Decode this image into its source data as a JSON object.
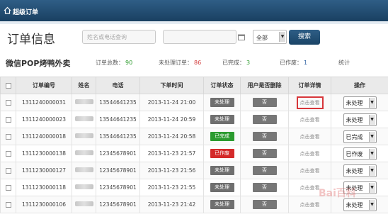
{
  "titlebar": {
    "title": "超级订单"
  },
  "heading": "订单信息",
  "search": {
    "placeholder": "姓名或电话查询",
    "date_value": "",
    "select_value": "全部",
    "button_label": "搜索"
  },
  "shop": {
    "name": "微信POP烤鸭外卖",
    "stats": [
      {
        "label": "订单总数：",
        "value": "90",
        "color": "#2e9b2e"
      },
      {
        "label": "未处理订单：",
        "value": "86",
        "color": "#d23a3a"
      },
      {
        "label": "已完成：",
        "value": "3",
        "color": "#2e9b2e"
      },
      {
        "label": "已作废：",
        "value": "1",
        "color": "#2a5ea0"
      },
      {
        "label": "统计",
        "value": "",
        "color": "#555"
      }
    ]
  },
  "table": {
    "headers": [
      "订单编号",
      "姓名",
      "电话",
      "下单时间",
      "订单状态",
      "用户是否删除",
      "订单详情",
      "操作"
    ],
    "rows": [
      {
        "id": "1311240000031",
        "phone": "13544641235",
        "time": "2013-11-24 21:00",
        "status": "未处理",
        "deleted": "否",
        "detail": "点击查看",
        "op": "未处理"
      },
      {
        "id": "1311240000023",
        "phone": "13544641235",
        "time": "2013-11-24 20:59",
        "status": "未处理",
        "deleted": "否",
        "detail": "点击查看",
        "op": "未处理"
      },
      {
        "id": "1311240000018",
        "phone": "13544641235",
        "time": "2013-11-24 20:58",
        "status": "已完成",
        "deleted": "否",
        "detail": "点击查看",
        "op": "已完成"
      },
      {
        "id": "1311230000138",
        "phone": "12345678901",
        "time": "2013-11-23 21:57",
        "status": "已作废",
        "deleted": "否",
        "detail": "点击查看",
        "op": "已作废"
      },
      {
        "id": "1311230000127",
        "phone": "12345678901",
        "time": "2013-11-23 21:56",
        "status": "未处理",
        "deleted": "否",
        "detail": "点击查看",
        "op": "未处理"
      },
      {
        "id": "1311230000118",
        "phone": "12345678901",
        "time": "2013-11-23 21:55",
        "status": "未处理",
        "deleted": "否",
        "detail": "点击查看",
        "op": "未处理"
      },
      {
        "id": "1311230000106",
        "phone": "12345678901",
        "time": "2013-11-23 21:42",
        "status": "未处理",
        "deleted": "否",
        "detail": "点击查看",
        "op": "未处理"
      }
    ]
  },
  "status_colors": {
    "未处理": "#6f6f6f",
    "已完成": "#2b9b2f",
    "已作废": "#d42a2a"
  }
}
